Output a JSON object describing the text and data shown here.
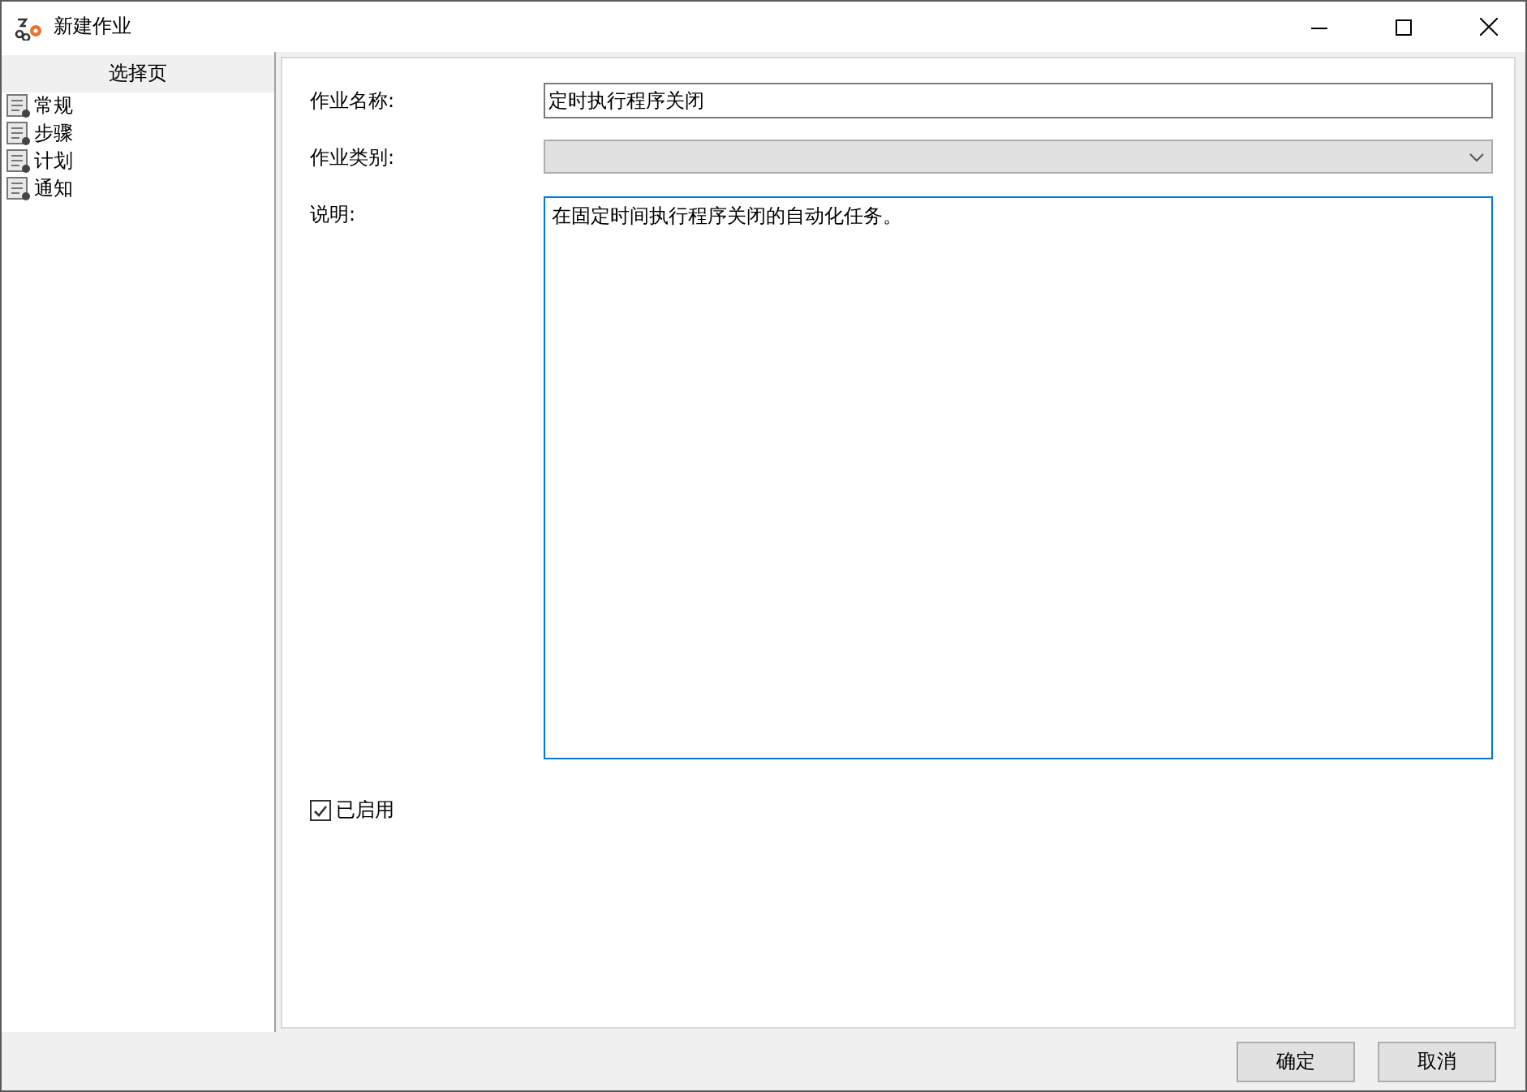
{
  "window": {
    "title": "新建作业"
  },
  "sidebar": {
    "header": "选择页",
    "items": [
      {
        "label": "常规",
        "selected": false
      },
      {
        "label": "步骤",
        "selected": false
      },
      {
        "label": "计划",
        "selected": false
      },
      {
        "label": "通知",
        "selected": false
      }
    ]
  },
  "form": {
    "name_label": "作业名称:",
    "name_value": "定时执行程序关闭",
    "category_label": "作业类别:",
    "category_disabled": true,
    "description_label": "说明:",
    "description_value": "在固定时间执行程序关闭的自动化任务。",
    "enabled": {
      "label": "已启用",
      "checked": true
    }
  },
  "buttons": [
    "确定",
    "取消"
  ]
}
